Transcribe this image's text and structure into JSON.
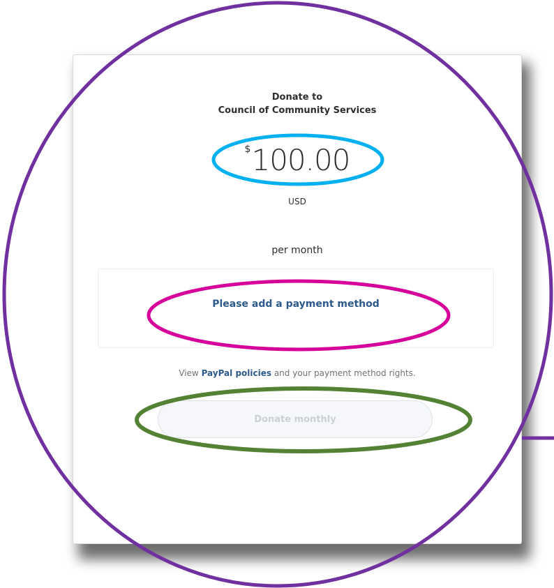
{
  "donation": {
    "title_line1": "Donate to",
    "title_line2": "Council of Community Services",
    "currency_symbol": "$",
    "amount": "100.00",
    "currency_code": "USD",
    "frequency": "per month"
  },
  "payment_method": {
    "prompt": "Please add a payment method"
  },
  "policies": {
    "prefix": "View ",
    "link": "PayPal policies",
    "suffix": " and your payment method rights."
  },
  "submit": {
    "label": "Donate monthly",
    "enabled": false
  },
  "annotations": {
    "outer_circle_color": "#7030a0",
    "amount_highlight_color": "#00b0f0",
    "payment_highlight_color": "#d6009a",
    "button_highlight_color": "#548235"
  },
  "colors": {
    "link": "#2c5a8c",
    "text": "#2c2e2f",
    "muted": "#6c7378",
    "disabled_button_bg": "#f5f7fa",
    "disabled_button_text": "#c9d0d6"
  }
}
